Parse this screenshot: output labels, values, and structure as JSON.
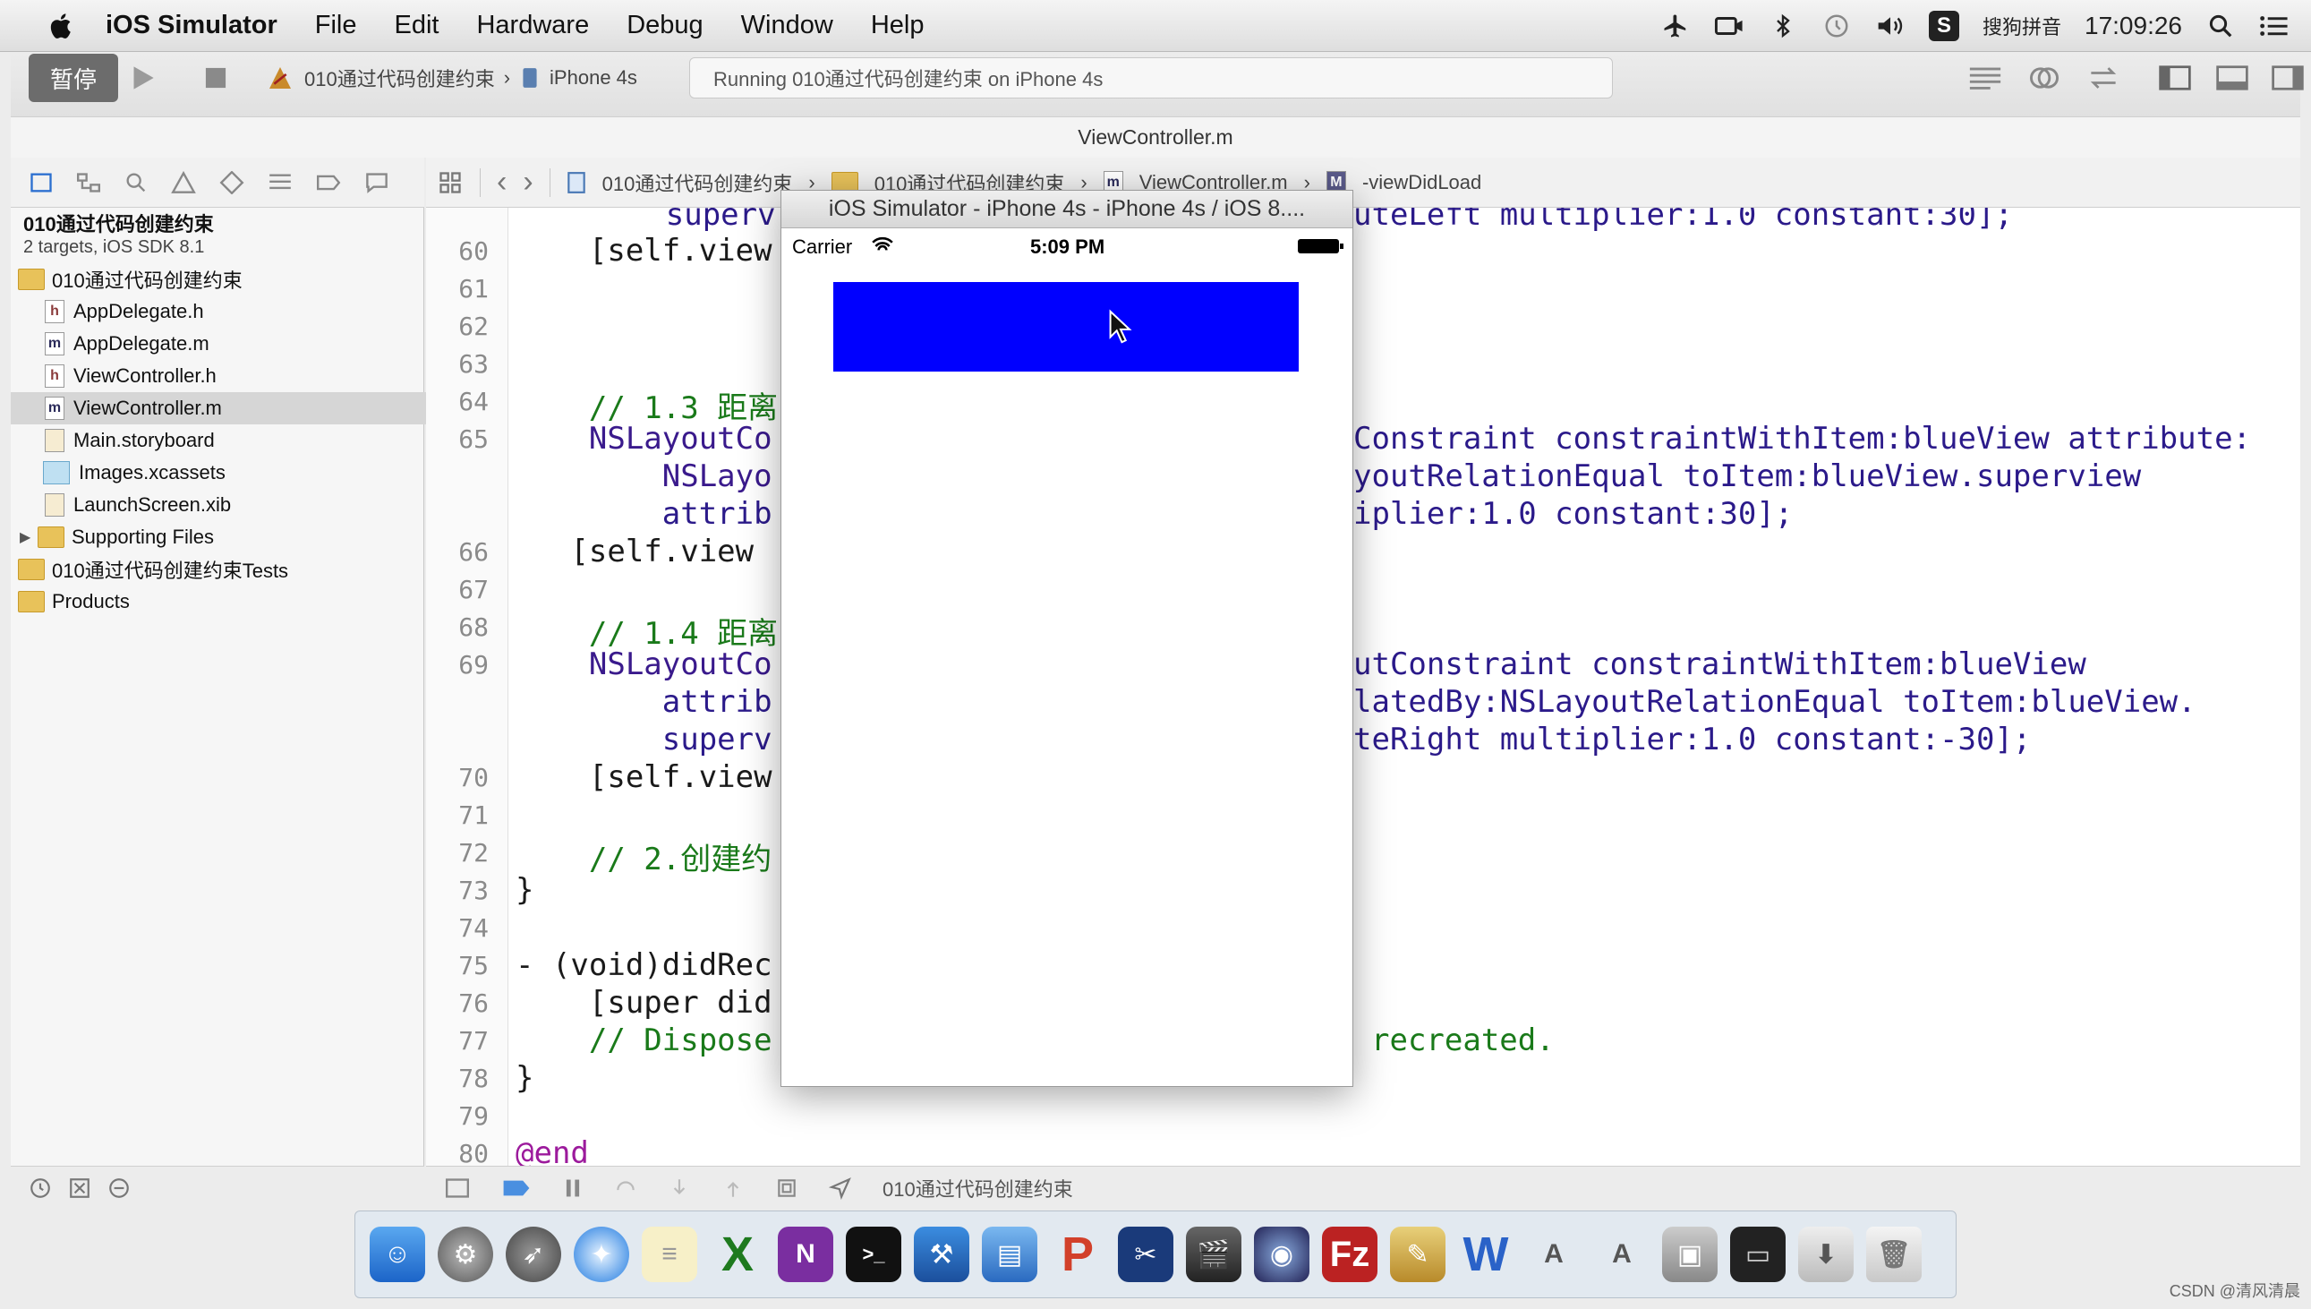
{
  "menubar": {
    "app_name": "iOS Simulator",
    "items": [
      "File",
      "Edit",
      "Hardware",
      "Debug",
      "Window",
      "Help"
    ],
    "ime_label": "搜狗拼音",
    "time": "17:09:26"
  },
  "toolbar": {
    "pause_label": "暂停",
    "scheme_name": "010通过代码创建约束",
    "device_name": "iPhone 4s",
    "activity_text": "Running 010通过代码创建约束 on iPhone 4s",
    "doc_title": "ViewController.m"
  },
  "navigator": {
    "project_name": "010通过代码创建约束",
    "project_subtitle": "2 targets, iOS SDK 8.1",
    "items": [
      {
        "label": "010通过代码创建约束",
        "icon": "folder"
      },
      {
        "label": "AppDelegate.h",
        "icon": "h"
      },
      {
        "label": "AppDelegate.m",
        "icon": "m"
      },
      {
        "label": "ViewController.h",
        "icon": "h"
      },
      {
        "label": "ViewController.m",
        "icon": "m"
      },
      {
        "label": "Main.storyboard",
        "icon": "storyboard"
      },
      {
        "label": "Images.xcassets",
        "icon": "xcassets"
      },
      {
        "label": "LaunchScreen.xib",
        "icon": "xib"
      },
      {
        "label": "Supporting Files",
        "icon": "folder"
      },
      {
        "label": "010通过代码创建约束Tests",
        "icon": "folder"
      },
      {
        "label": "Products",
        "icon": "folder"
      }
    ]
  },
  "jumpbar": {
    "crumbs": [
      "010通过代码创建约束",
      "010通过代码创建约束",
      "ViewController.m",
      "-viewDidLoad"
    ]
  },
  "editor": {
    "line_numbers": [
      "60",
      "61",
      "62",
      "63",
      "64",
      "65",
      "66",
      "67",
      "68",
      "69",
      "70",
      "71",
      "72",
      "73",
      "74",
      "75",
      "76",
      "77",
      "78",
      "79",
      "80"
    ],
    "code": {
      "l59": "        superv",
      "l59b": "uteLeft multiplier:1.0 constant:30];",
      "l60": "    [self.view",
      "l64": "    // 1.3 距离",
      "l65": "    NSLayoutCo",
      "l65b": "Constraint constraintWithItem:blueView attribute:",
      "l65c1": "        NSLayo",
      "l65c2": "youtRelationEqual toItem:blueView.superview",
      "l65d1": "        attrib",
      "l65d2": "iplier:1.0 constant:30];",
      "l66": "   [self.view",
      "l68": "    // 1.4 距离",
      "l69": "    NSLayoutCo",
      "l69b": "utConstraint constraintWithItem:blueView",
      "l69c1": "        attrib",
      "l69c2": "latedBy:NSLayoutRelationEqual toItem:blueView.",
      "l69d1": "        superv",
      "l69d2": "teRight multiplier:1.0 constant:-30];",
      "l70": "    [self.view",
      "l72": "    // 2.创建约",
      "l73": "}",
      "l75": "- (void)didRec",
      "l76": "    [super did",
      "l77": "    // Dispose",
      "l77b": "recreated.",
      "l78": "}",
      "l80": "@end"
    }
  },
  "debugbar": {
    "target_label": "010通过代码创建约束"
  },
  "simulator": {
    "title": "iOS Simulator - iPhone 4s - iPhone 4s / iOS 8....",
    "carrier": "Carrier",
    "time": "5:09 PM",
    "blue_view_color": "#0000ff"
  },
  "watermark": "CSDN @清风清晨"
}
